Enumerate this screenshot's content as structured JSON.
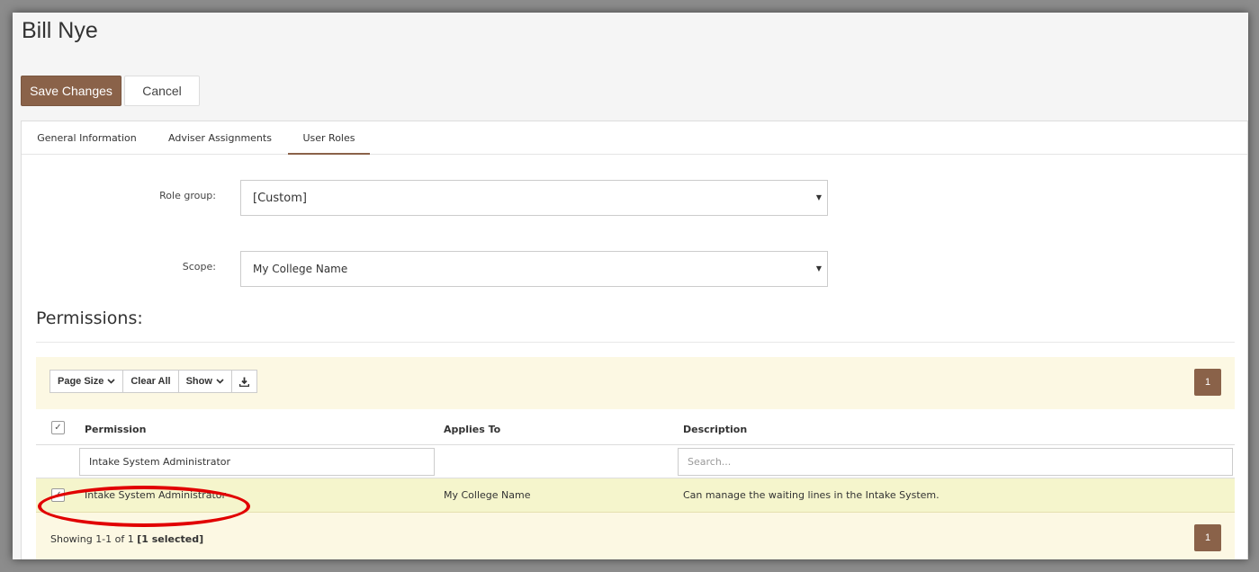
{
  "header": {
    "title": "Bill Nye",
    "save_label": "Save Changes",
    "cancel_label": "Cancel"
  },
  "tabs": [
    {
      "label": "General Information",
      "active": false
    },
    {
      "label": "Adviser Assignments",
      "active": false
    },
    {
      "label": "User Roles",
      "active": true
    }
  ],
  "form": {
    "role_group_label": "Role group:",
    "role_group_value": "[Custom]",
    "scope_label": "Scope:",
    "scope_value": "My College Name"
  },
  "permissions": {
    "title": "Permissions:",
    "toolbar": {
      "page_size": "Page Size",
      "clear_all": "Clear All",
      "show": "Show"
    },
    "pager_top": "1",
    "pager_bottom": "1",
    "columns": {
      "permission": "Permission",
      "applies_to": "Applies To",
      "description": "Description"
    },
    "filters": {
      "permission_value": "Intake System Administrator",
      "description_placeholder": "Search..."
    },
    "rows": [
      {
        "checked": true,
        "permission": "Intake System Administrator",
        "applies_to": "My College Name",
        "description": "Can manage the waiting lines in the Intake System."
      }
    ],
    "footer": {
      "showing": "Showing 1-1 of 1",
      "selected": "[1 selected]"
    }
  },
  "colors": {
    "accent": "#8a6249",
    "grid_background": "#fcf8e3",
    "selected_row": "#f5f5cc",
    "annotation": "#e10000"
  }
}
